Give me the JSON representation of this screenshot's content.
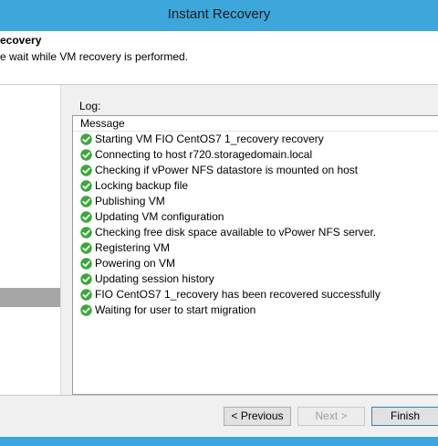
{
  "window": {
    "title": "Instant Recovery"
  },
  "header": {
    "title": "ecovery",
    "subtitle": "e wait while VM recovery is performed."
  },
  "log": {
    "label": "Log:",
    "column_header": "Message",
    "entries": [
      "Starting VM FIO CentOS7 1_recovery recovery",
      "Connecting to host r720.storagedomain.local",
      "Checking if vPower NFS datastore is mounted on host",
      "Locking backup file",
      "Publishing VM",
      "Updating VM configuration",
      "Checking free disk space available to vPower NFS server.",
      "Registering VM",
      "Powering on VM",
      "Updating session history",
      "FIO CentOS7 1_recovery has been recovered successfully",
      "Waiting for user to start migration"
    ]
  },
  "buttons": {
    "previous": "< Previous",
    "next": "Next >",
    "finish": "Finish"
  },
  "colors": {
    "accent": "#3da7dc",
    "success": "#3aa83a"
  }
}
